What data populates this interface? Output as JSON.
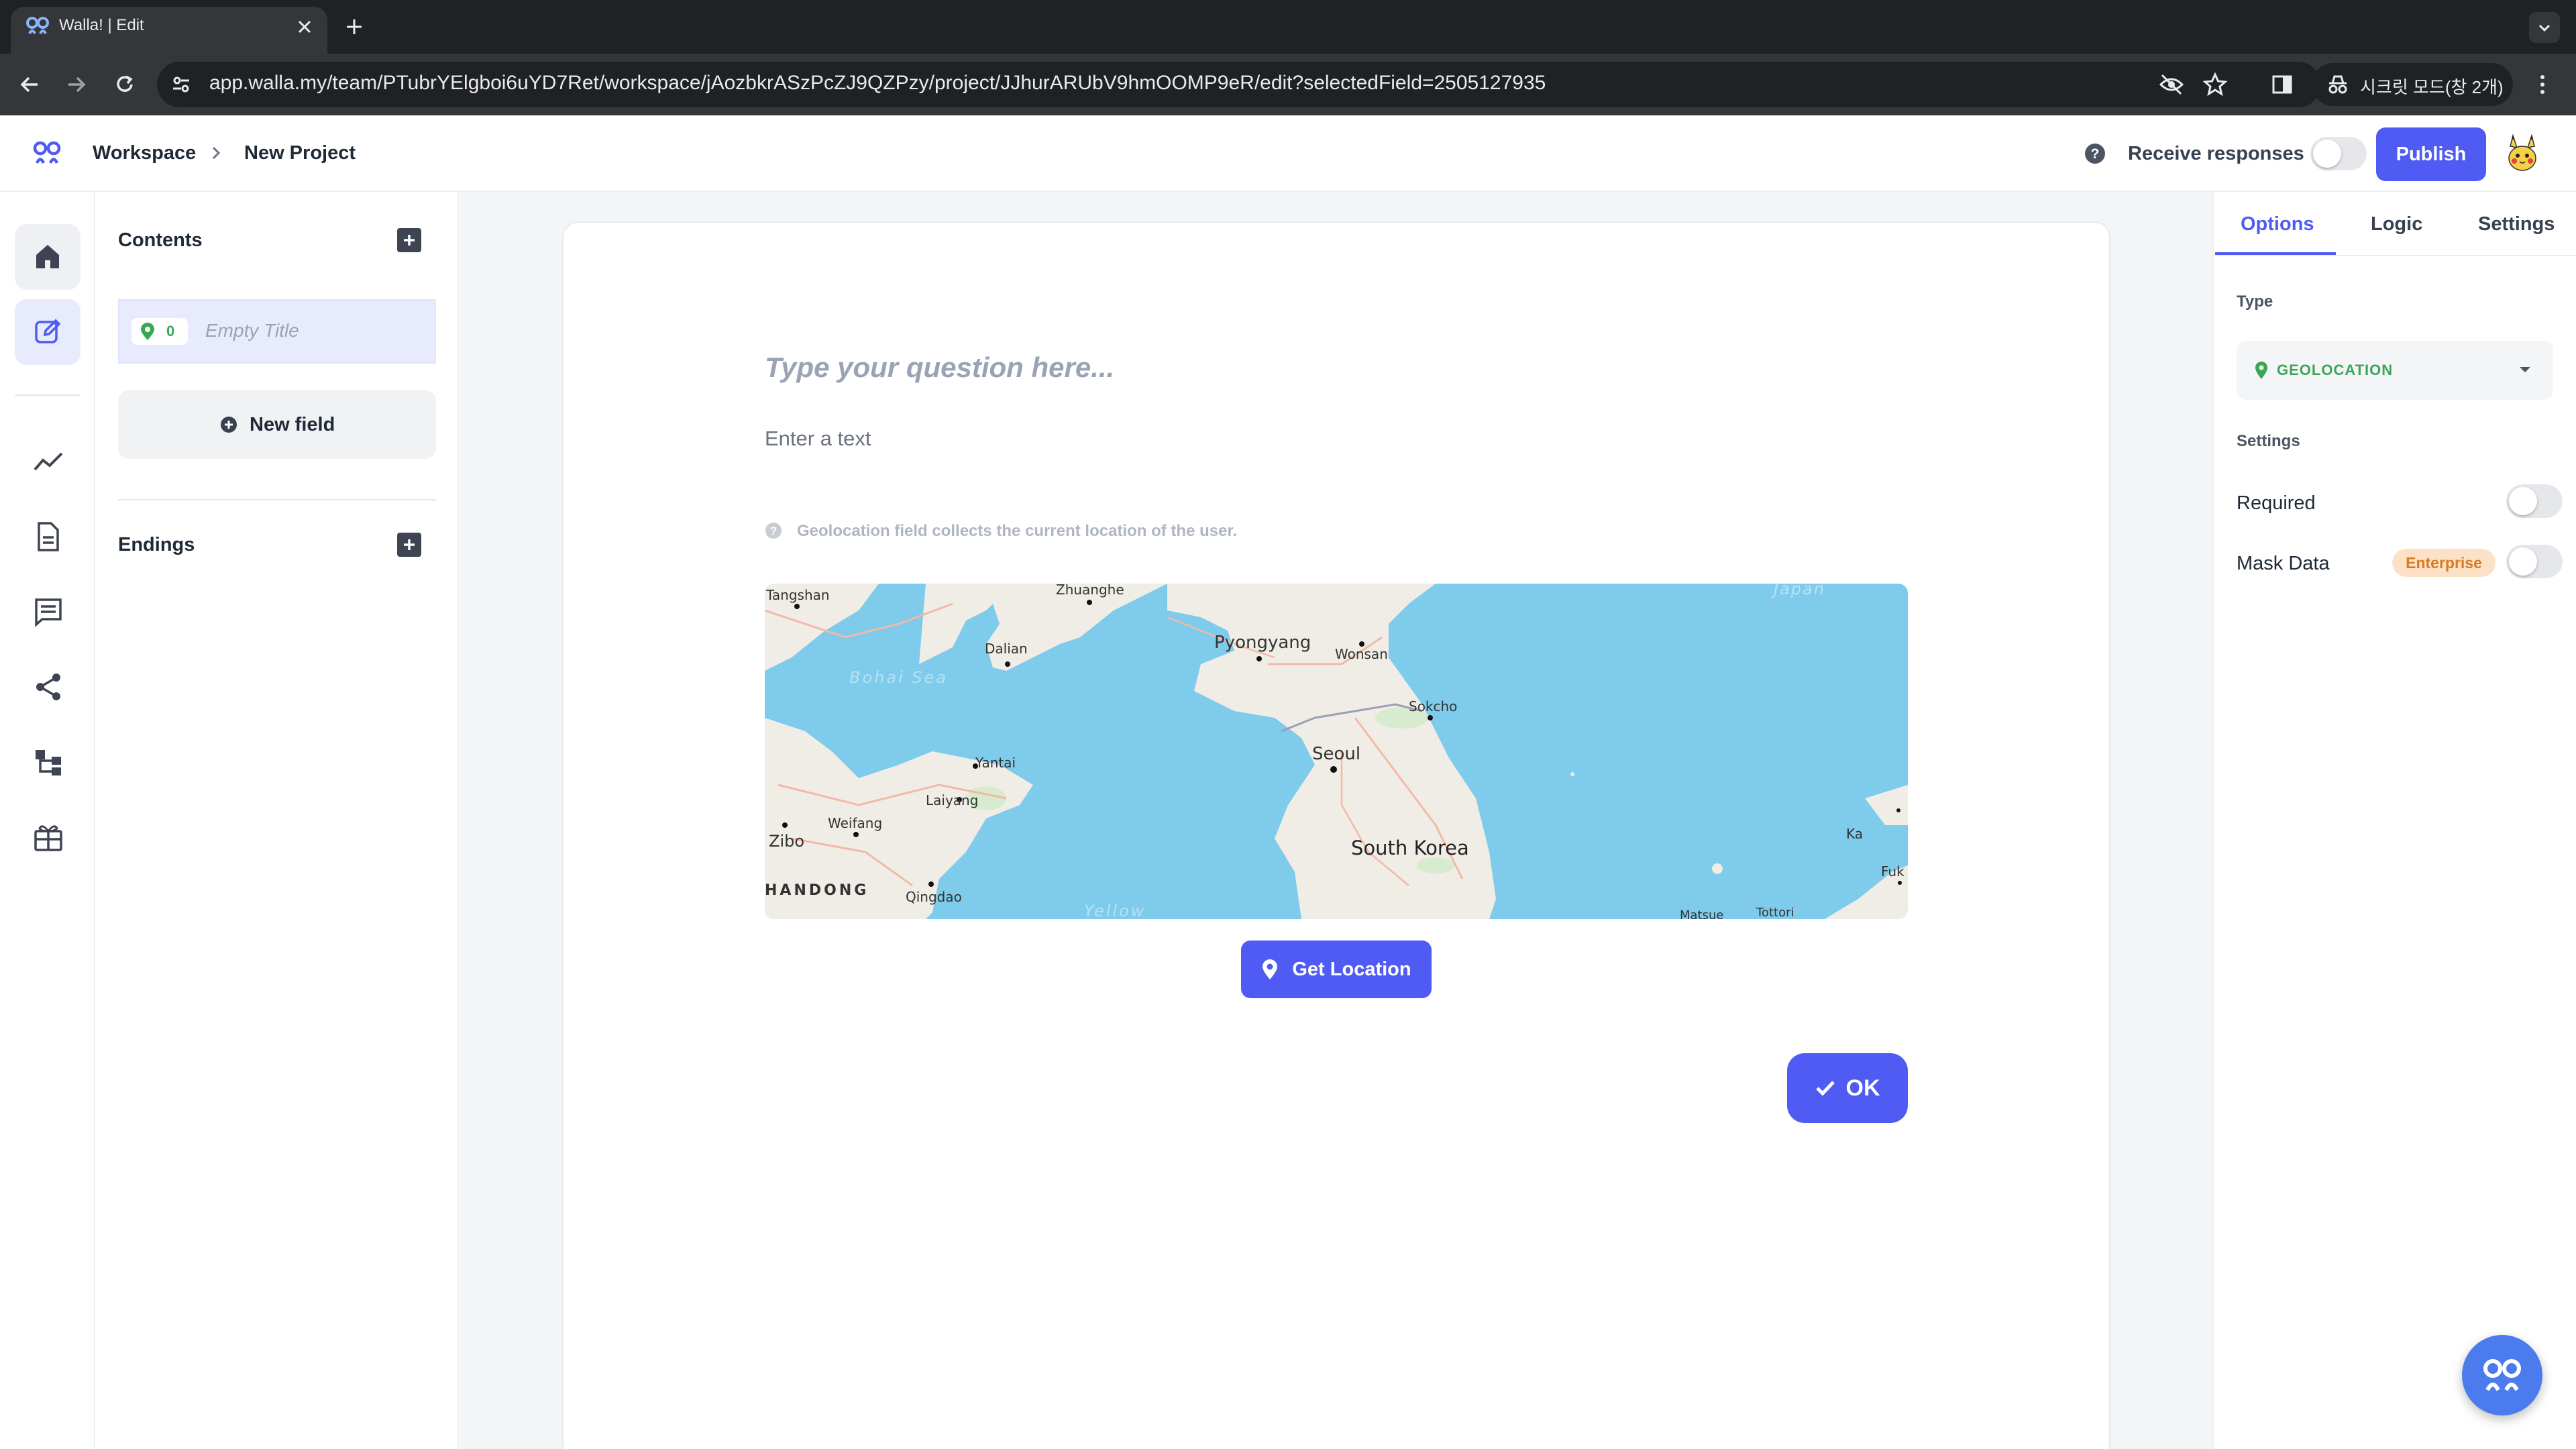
{
  "browser": {
    "tab_title": "Walla! | Edit",
    "url": "app.walla.my/team/PTubrYElgboi6uYD7Ret/workspace/jAozbkrASzPcZJ9QZPzy/project/JJhurARUbV9hmOOMP9eR/edit?selectedField=2505127935",
    "incognito_label": "시크릿 모드(창 2개)"
  },
  "header": {
    "breadcrumb_workspace": "Workspace",
    "breadcrumb_project": "New Project",
    "receive_responses_label": "Receive responses",
    "receive_responses_on": false,
    "publish_label": "Publish"
  },
  "rail": {
    "items": [
      "home-icon",
      "edit-icon",
      "analytics-icon",
      "document-icon",
      "responses-icon",
      "share-icon",
      "integrations-icon",
      "gift-icon"
    ]
  },
  "sidebar": {
    "contents_heading": "Contents",
    "field_badge_count": "0",
    "field_title": "Empty Title",
    "new_field_label": "New field",
    "endings_heading": "Endings"
  },
  "form": {
    "question_placeholder": "Type your question here...",
    "description_placeholder": "Enter a text",
    "helper_text": "Geolocation field collects the current location of the user.",
    "get_location_label": "Get Location",
    "ok_label": "OK"
  },
  "map": {
    "labels": {
      "tangshan": "Tangshan",
      "zhuanghe": "Zhuanghe",
      "japan": "Japan",
      "pyongyang": "Pyongyang",
      "wonsan": "Wonsan",
      "dalian": "Dalian",
      "bohai": "Bohai Sea",
      "sokcho": "Sokcho",
      "seoul": "Seoul",
      "yantai": "Yantai",
      "laiyang": "Laiyang",
      "weifang": "Weifang",
      "zibo": "Zibo",
      "south_korea": "South Korea",
      "shandong": "HANDONG",
      "qingdao": "Qingdao",
      "yellow": "Yellow",
      "ka": "Ka",
      "fuk": "Fuk",
      "matsue": "Matsue",
      "tottori": "Tottori"
    }
  },
  "right_panel": {
    "tabs": [
      "Options",
      "Logic",
      "Settings"
    ],
    "active_tab": "Options",
    "type_label": "Type",
    "type_value": "GEOLOCATION",
    "settings_label": "Settings",
    "required_label": "Required",
    "required_on": false,
    "mask_data_label": "Mask Data",
    "mask_data_badge": "Enterprise",
    "mask_data_on": false
  },
  "colors": {
    "accent": "#4f5bf3",
    "water": "#7ecbeb",
    "land": "#f0ede6",
    "geo_green": "#3aa655",
    "enterprise_bg": "#fde1c7",
    "enterprise_text": "#d97a1e"
  }
}
